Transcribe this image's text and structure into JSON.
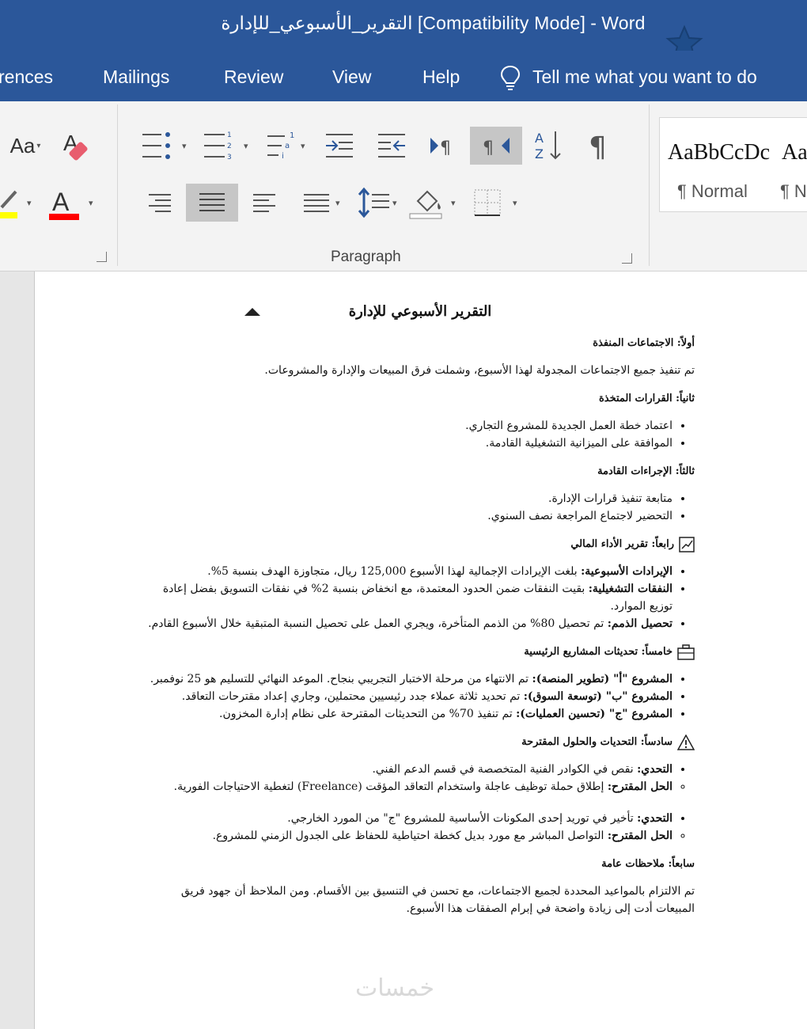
{
  "window": {
    "title": "التقرير_الأسبوعي_للإدارة [Compatibility Mode]  -  Word"
  },
  "tabs": [
    {
      "label": "rences"
    },
    {
      "label": "Mailings"
    },
    {
      "label": "Review"
    },
    {
      "label": "View"
    },
    {
      "label": "Help"
    },
    {
      "label": "Tell me what you want to do"
    }
  ],
  "ribbon": {
    "font_size_label": "Aa",
    "paragraph_group": "Paragraph",
    "styles": [
      {
        "preview": "AaBbCcDc",
        "name": "¶ Normal"
      },
      {
        "preview": "Aa",
        "name": "¶ N"
      }
    ],
    "colors": {
      "accent": "#2b579a",
      "highlight": "#ffff00",
      "font_color": "#ff0000"
    }
  },
  "document": {
    "title": "التقرير الأسبوعي للإدارة",
    "s1_title": "أولاً: الاجتماعات المنفذة",
    "s1_text": "تم تنفيذ جميع الاجتماعات المجدولة لهذا الأسبوع، وشملت فرق المبيعات والإدارة والمشروعات.",
    "s2_title": "ثانياً: القرارات المتخذة",
    "s2_items": [
      "اعتماد خطة العمل الجديدة للمشروع التجاري.",
      "الموافقة على الميزانية التشغيلية القادمة."
    ],
    "s3_title": "ثالثاً: الإجراءات القادمة",
    "s3_items": [
      "متابعة تنفيذ قرارات الإدارة.",
      "التحضير لاجتماع المراجعة نصف السنوي."
    ],
    "s4_title": "رابعاً: تقرير الأداء المالي",
    "s4_items": [
      {
        "label": "الإيرادات الأسبوعية:",
        "text": " بلغت الإيرادات الإجمالية لهذا الأسبوع 125,000 ريال، متجاوزة الهدف بنسبة 5%."
      },
      {
        "label": "النفقات التشغيلية:",
        "text": " بقيت النفقات ضمن الحدود المعتمدة، مع انخفاض بنسبة 2% في نفقات التسويق بفضل إعادة توزيع الموارد."
      },
      {
        "label": "تحصيل الذمم:",
        "text": " تم تحصيل 80% من الذمم المتأخرة، ويجري العمل على تحصيل النسبة المتبقية خلال الأسبوع القادم."
      }
    ],
    "s5_title": "خامساً: تحديثات المشاريع الرئيسية",
    "s5_items": [
      {
        "label": "المشروع \"أ\" (تطوير المنصة):",
        "text": " تم الانتهاء من مرحلة الاختبار التجريبي بنجاح. الموعد النهائي للتسليم هو 25 نوفمبر."
      },
      {
        "label": "المشروع \"ب\" (توسعة السوق):",
        "text": " تم تحديد ثلاثة عملاء جدد رئيسيين محتملين، وجاري إعداد مقترحات التعاقد."
      },
      {
        "label": "المشروع \"ج\" (تحسين العمليات):",
        "text": " تم تنفيذ 70% من التحديثات المقترحة على نظام إدارة المخزون."
      }
    ],
    "s6_title": "سادساً: التحديات والحلول المقترحة",
    "s6_pairs": [
      {
        "challenge_label": "التحدي:",
        "challenge": " نقص في الكوادر الفنية المتخصصة في قسم الدعم الفني.",
        "solution_label": "الحل المقترح:",
        "solution": " إطلاق حملة توظيف عاجلة واستخدام التعاقد المؤقت (Freelance) لتغطية الاحتياجات الفورية."
      },
      {
        "challenge_label": "التحدي:",
        "challenge": " تأخير في توريد إحدى المكونات الأساسية للمشروع \"ج\" من المورد الخارجي.",
        "solution_label": "الحل المقترح:",
        "solution": " التواصل المباشر مع مورد بديل كخطة احتياطية للحفاظ على الجدول الزمني للمشروع."
      }
    ],
    "s7_title": "سابعاً: ملاحظات عامة",
    "s7_text": "تم الالتزام بالمواعيد المحددة لجميع الاجتماعات، مع تحسن في التنسيق بين الأقسام. ومن الملاحظ أن جهود فريق المبيعات أدت إلى زيادة واضحة في إبرام الصفقات هذا الأسبوع.",
    "watermark": "خمسات"
  }
}
